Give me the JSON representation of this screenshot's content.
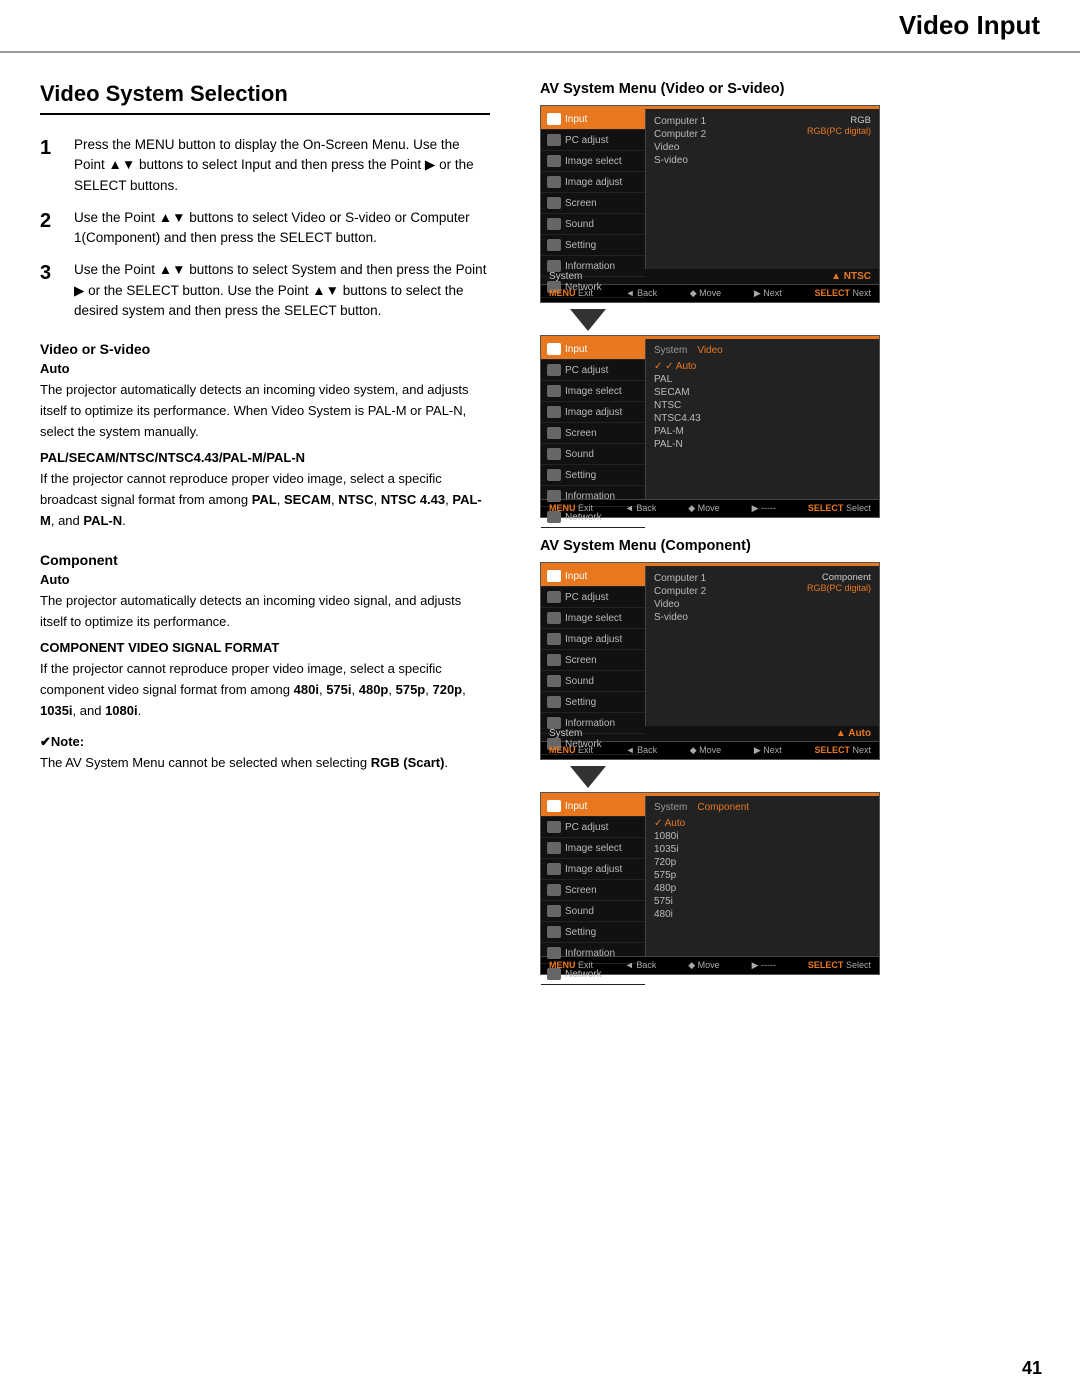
{
  "header": {
    "title": "Video Input"
  },
  "page": {
    "section_title": "Video System Selection",
    "steps": [
      {
        "num": "1",
        "text": "Press the MENU button to display the On-Screen Menu. Use the Point ▲▼ buttons to select Input and then press the Point ▶ or the SELECT buttons."
      },
      {
        "num": "2",
        "text": "Use the Point ▲▼ buttons to select Video or S-video or Computer 1(Component) and then press the SELECT button."
      },
      {
        "num": "3",
        "text": "Use the Point ▲▼ buttons to select System and then press the Point ▶ or the SELECT button. Use the Point ▲▼ buttons to select the desired system and then press the SELECT button."
      }
    ],
    "video_sv_title": "Video or S-video",
    "auto_label": "Auto",
    "auto_desc": "The projector automatically detects an incoming video system, and adjusts itself to optimize its performance. When Video System is PAL-M or PAL-N, select the system manually.",
    "pal_title": "PAL/SECAM/NTSC/NTSC4.43/PAL-M/PAL-N",
    "pal_desc": "If the projector cannot reproduce proper video image, select a specific broadcast signal format from among PAL, SECAM, NTSC, NTSC 4.43, PAL-M, and PAL-N.",
    "component_title": "Component",
    "comp_auto_label": "Auto",
    "comp_auto_desc": "The projector automatically detects an incoming video signal, and adjusts itself to optimize its performance.",
    "comp_signal_title": "COMPONENT VIDEO SIGNAL FORMAT",
    "comp_signal_desc": "If the projector cannot reproduce proper video image, select a specific component video signal format from among 480i, 575i, 480p, 575p, 720p, 1035i, and 1080i.",
    "note_title": "✔Note:",
    "note_text": "The AV System Menu cannot be selected when selecting RGB (Scart).",
    "page_num": "41"
  },
  "av_menu_video": {
    "title": "AV System Menu (Video or S-video)",
    "menu1": {
      "left_items": [
        {
          "label": "Input",
          "selected": true
        },
        {
          "label": "PC adjust",
          "selected": false
        },
        {
          "label": "Image select",
          "selected": false
        },
        {
          "label": "Image adjust",
          "selected": false
        },
        {
          "label": "Screen",
          "selected": false
        },
        {
          "label": "Sound",
          "selected": false
        },
        {
          "label": "Setting",
          "selected": false
        },
        {
          "label": "Information",
          "selected": false
        },
        {
          "label": "Network",
          "selected": false
        }
      ],
      "right_items_col1": [
        "Computer 1",
        "Computer 2",
        "Video",
        "S-video"
      ],
      "right_items_col2_label": "RGB",
      "right_items_col2_sub": "RGB(PC digital)",
      "system_label": "System",
      "system_value": "▲ NTSC",
      "bottom": [
        "MENU Exit",
        "◄ Back",
        "◆ Move",
        "▶ Next",
        "SELECT Next"
      ]
    },
    "menu2": {
      "left_items": [
        {
          "label": "Input",
          "selected": true
        },
        {
          "label": "PC adjust",
          "selected": false
        },
        {
          "label": "Image select",
          "selected": false
        },
        {
          "label": "Image adjust",
          "selected": false
        },
        {
          "label": "Screen",
          "selected": false
        },
        {
          "label": "Sound",
          "selected": false
        },
        {
          "label": "Setting",
          "selected": false
        },
        {
          "label": "Information",
          "selected": false
        },
        {
          "label": "Network",
          "selected": false
        }
      ],
      "system_header_col1": "System",
      "system_header_col2": "Video",
      "right_options": [
        {
          "label": "Auto",
          "checked": true
        },
        {
          "label": "PAL",
          "checked": false
        },
        {
          "label": "SECAM",
          "checked": false
        },
        {
          "label": "NTSC",
          "checked": false
        },
        {
          "label": "NTSC4.43",
          "checked": false
        },
        {
          "label": "PAL-M",
          "checked": false
        },
        {
          "label": "PAL-N",
          "checked": false
        }
      ],
      "bottom": [
        "MENU Exit",
        "◄ Back",
        "◆ Move",
        "▶ -----",
        "SELECT Select"
      ]
    }
  },
  "av_menu_component": {
    "title": "AV System Menu (Component)",
    "menu1": {
      "left_items": [
        {
          "label": "Input",
          "selected": true
        },
        {
          "label": "PC adjust",
          "selected": false
        },
        {
          "label": "Image select",
          "selected": false
        },
        {
          "label": "Image adjust",
          "selected": false
        },
        {
          "label": "Screen",
          "selected": false
        },
        {
          "label": "Sound",
          "selected": false
        },
        {
          "label": "Setting",
          "selected": false
        },
        {
          "label": "Information",
          "selected": false
        },
        {
          "label": "Network",
          "selected": false
        }
      ],
      "right_items_col1": [
        "Computer 1",
        "Computer 2",
        "Video",
        "S-video"
      ],
      "right_items_col2_label": "Component",
      "right_items_col2_sub": "RGB(PC digital)",
      "system_label": "System",
      "system_value": "▲ Auto",
      "bottom": [
        "MENU Exit",
        "◄ Back",
        "◆ Move",
        "▶ Next",
        "SELECT Next"
      ]
    },
    "menu2": {
      "left_items": [
        {
          "label": "Input",
          "selected": true
        },
        {
          "label": "PC adjust",
          "selected": false
        },
        {
          "label": "Image select",
          "selected": false
        },
        {
          "label": "Image adjust",
          "selected": false
        },
        {
          "label": "Screen",
          "selected": false
        },
        {
          "label": "Sound",
          "selected": false
        },
        {
          "label": "Setting",
          "selected": false
        },
        {
          "label": "Information",
          "selected": false
        },
        {
          "label": "Network",
          "selected": false
        }
      ],
      "system_header_col1": "System",
      "system_header_col2": "Component",
      "right_options": [
        {
          "label": "Auto",
          "checked": true
        },
        {
          "label": "1080i",
          "checked": false
        },
        {
          "label": "1035i",
          "checked": false
        },
        {
          "label": "720p",
          "checked": false
        },
        {
          "label": "575p",
          "checked": false
        },
        {
          "label": "480p",
          "checked": false
        },
        {
          "label": "575i",
          "checked": false
        },
        {
          "label": "480i",
          "checked": false
        }
      ],
      "bottom": [
        "MENU Exit",
        "◄ Back",
        "◆ Move",
        "▶ -----",
        "SELECT Select"
      ]
    }
  }
}
